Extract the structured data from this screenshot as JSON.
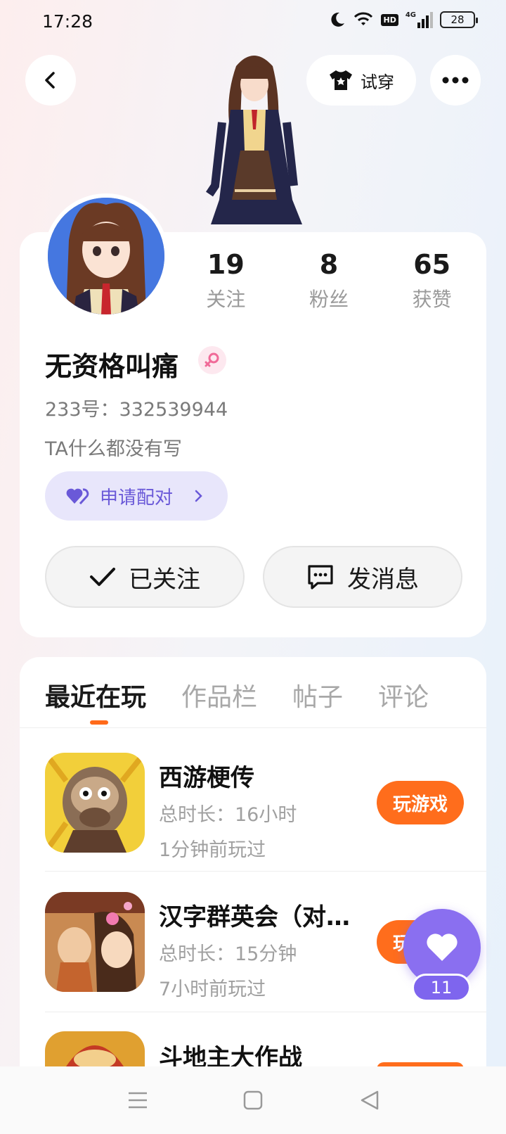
{
  "status_bar": {
    "time": "17:28",
    "network": "4G",
    "hd": "HD",
    "battery": "28"
  },
  "header": {
    "try_on_label": "试穿"
  },
  "profile": {
    "stats": [
      {
        "value": "19",
        "label": "关注"
      },
      {
        "value": "8",
        "label": "粉丝"
      },
      {
        "value": "65",
        "label": "获赞"
      }
    ],
    "username": "无资格叫痛",
    "uid": "233号：332539944",
    "bio": "TA什么都没有写",
    "pair_label": "申请配对",
    "follow_label": "已关注",
    "message_label": "发消息"
  },
  "tabs": [
    "最近在玩",
    "作品栏",
    "帖子",
    "评论"
  ],
  "games": [
    {
      "name": "西游梗传",
      "total_time": "总时长：16小时",
      "last_played": "1分钟前玩过",
      "play_label": "玩游戏"
    },
    {
      "name": "汉字群英会（对…",
      "total_time": "总时长：15分钟",
      "last_played": "7小时前玩过",
      "play_label": "玩游戏"
    },
    {
      "name": "斗地主大作战",
      "total_time": "",
      "last_played": "",
      "play_label": ""
    }
  ],
  "like_fab": {
    "count": "11"
  },
  "colors": {
    "accent": "#ff6d1c",
    "purple": "#8a6ff0",
    "pair_text": "#6a59d8"
  }
}
